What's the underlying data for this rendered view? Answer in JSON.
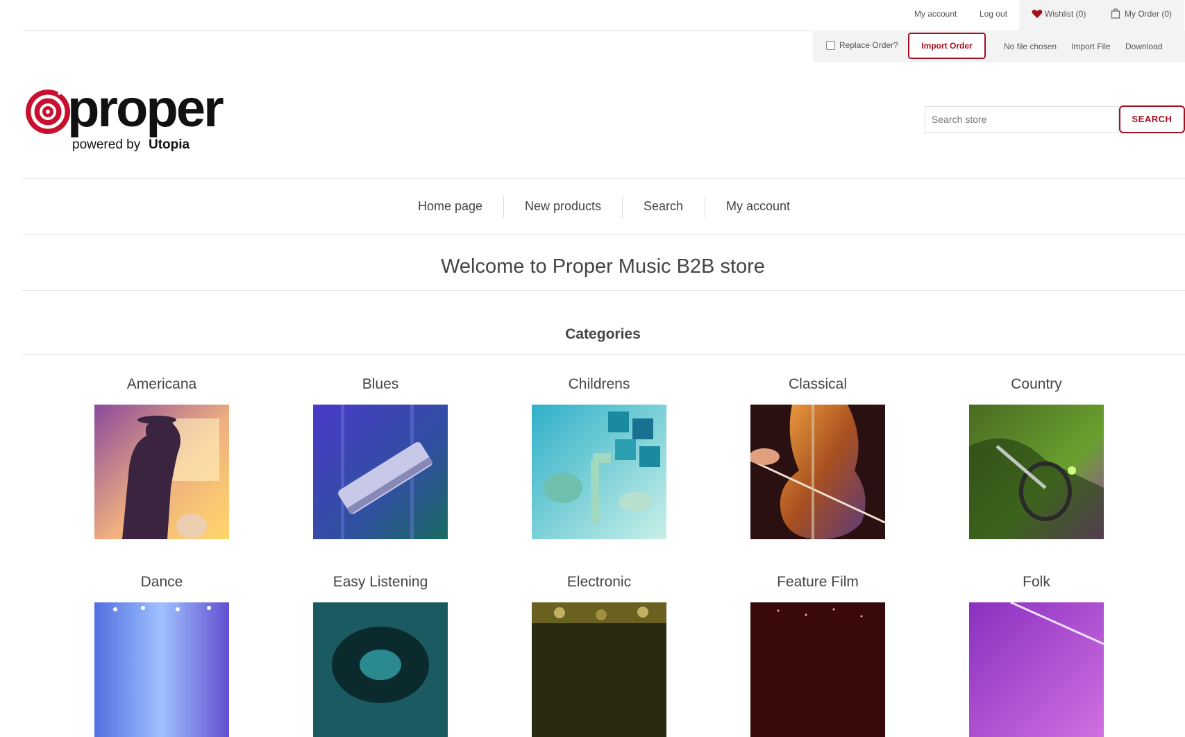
{
  "header": {
    "my_account": "My account",
    "log_out": "Log out",
    "wishlist": "Wishlist (0)",
    "my_order": "My Order (0)"
  },
  "import_bar": {
    "replace_order": "Replace Order?",
    "import_order": "Import Order",
    "no_file": "No file chosen",
    "import_file": "Import File",
    "download": "Download"
  },
  "logo": {
    "brand": "proper",
    "tagline_prefix": "powered by",
    "tagline_brand": "Utopia"
  },
  "search": {
    "placeholder": "Search store",
    "button": "SEARCH"
  },
  "nav": {
    "items": [
      "Home page",
      "New products",
      "Search",
      "My account"
    ]
  },
  "main": {
    "welcome": "Welcome to Proper Music B2B store",
    "categories_title": "Categories",
    "categories": [
      {
        "name": "Americana",
        "icon": "silhouette-couple-image"
      },
      {
        "name": "Blues",
        "icon": "harmonica-image"
      },
      {
        "name": "Childrens",
        "icon": "toys-image"
      },
      {
        "name": "Classical",
        "icon": "cello-image"
      },
      {
        "name": "Country",
        "icon": "singer-microphone-image"
      },
      {
        "name": "Dance",
        "icon": "stage-lights-image"
      },
      {
        "name": "Easy Listening",
        "icon": "vinyl-record-image"
      },
      {
        "name": "Electronic",
        "icon": "mixing-desk-image"
      },
      {
        "name": "Feature Film",
        "icon": "cinema-image"
      },
      {
        "name": "Folk",
        "icon": "violin-image"
      }
    ]
  },
  "colors": {
    "accent": "#a50f1f",
    "text": "#444444",
    "border": "#e2e2e2"
  }
}
